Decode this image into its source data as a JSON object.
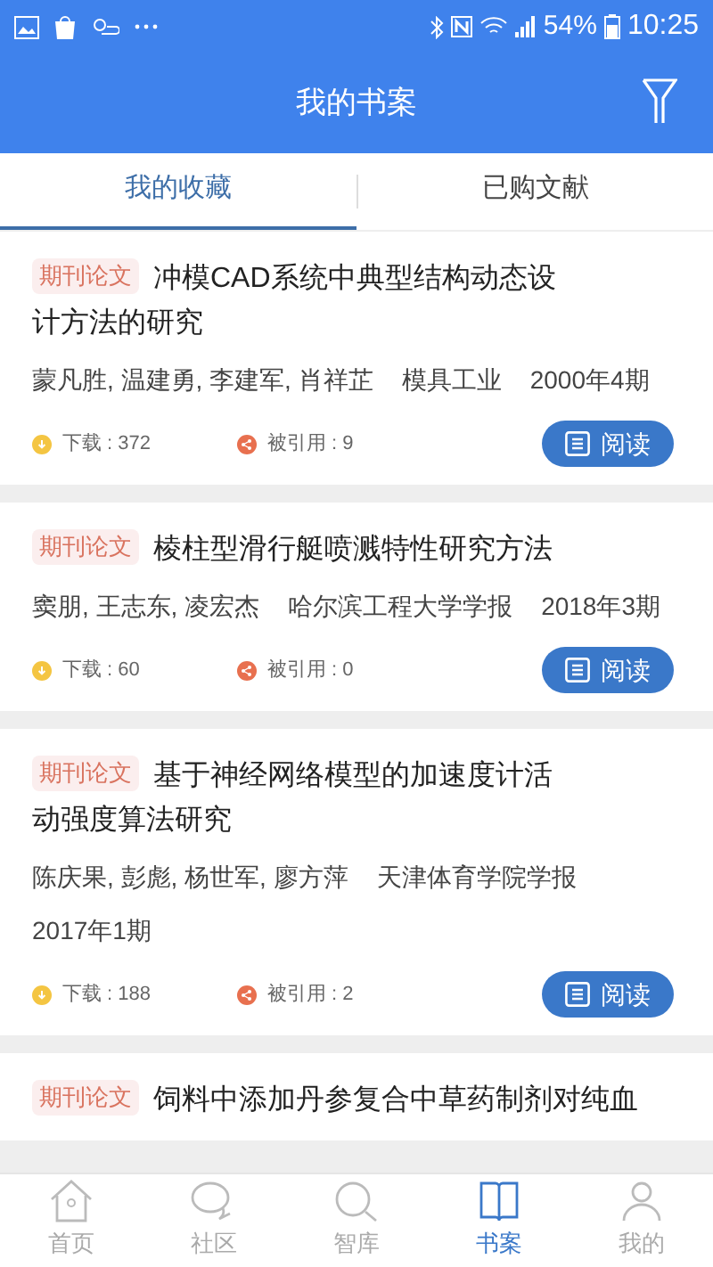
{
  "status_bar": {
    "battery": "54%",
    "time": "10:25"
  },
  "header": {
    "title": "我的书案"
  },
  "tabs": [
    {
      "label": "我的收藏",
      "selected": true
    },
    {
      "label": "已购文献",
      "selected": false
    }
  ],
  "articles": [
    {
      "tag": "期刊论文",
      "title": "冲模CAD系统中典型结构动态设计方法的研究",
      "authors": "蒙凡胜, 温建勇, 李建军, 肖祥芷",
      "journal": "模具工业",
      "issue": "2000年4期",
      "downloads": "下载 : 372",
      "citations": "被引用 : 9",
      "button": "阅读"
    },
    {
      "tag": "期刊论文",
      "title": "棱柱型滑行艇喷溅特性研究方法",
      "authors": "窦朋, 王志东, 凌宏杰",
      "journal": "哈尔滨工程大学学报",
      "issue": "2018年3期",
      "downloads": "下载 : 60",
      "citations": "被引用 : 0",
      "button": "阅读"
    },
    {
      "tag": "期刊论文",
      "title": "基于神经网络模型的加速度计活动强度算法研究",
      "authors": "陈庆果, 彭彪, 杨世军, 廖方萍",
      "journal": "天津体育学院学报",
      "issue": "2017年1期",
      "downloads": "下载 : 188",
      "citations": "被引用 : 2",
      "button": "阅读"
    },
    {
      "tag": "期刊论文",
      "title": "饲料中添加丹参复合中草药制剂对纯血"
    }
  ],
  "bottom_nav": [
    {
      "label": "首页",
      "selected": false
    },
    {
      "label": "社区",
      "selected": false
    },
    {
      "label": "智库",
      "selected": false
    },
    {
      "label": "书案",
      "selected": true
    },
    {
      "label": "我的",
      "selected": false
    }
  ]
}
